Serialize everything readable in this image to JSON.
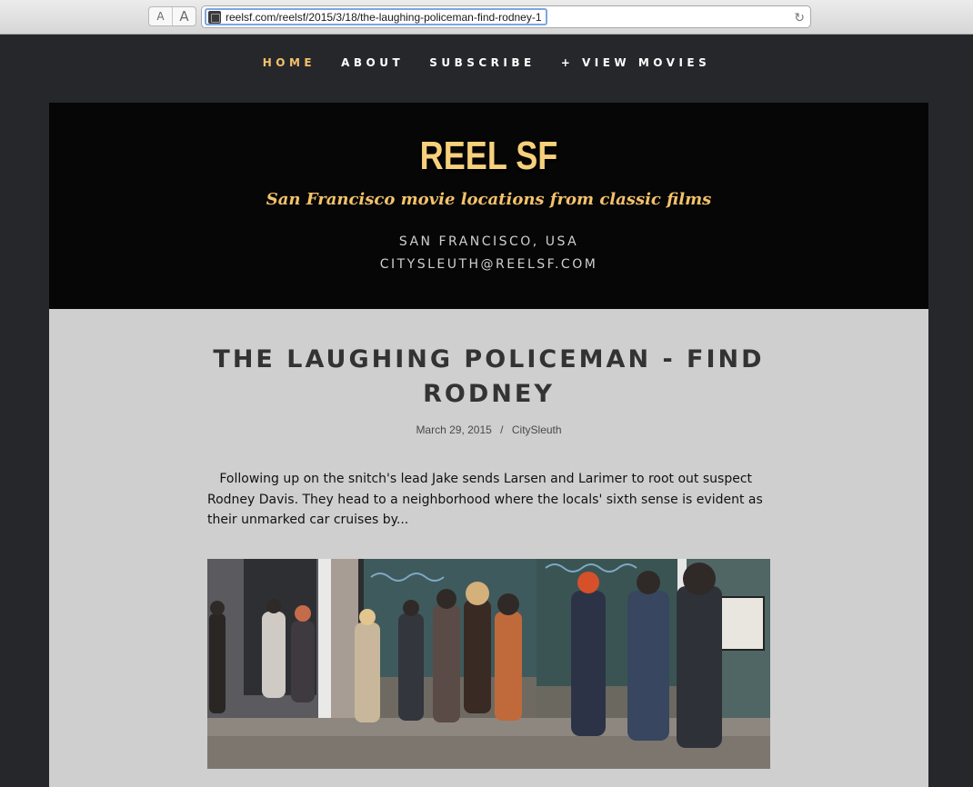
{
  "browser": {
    "font_small": "A",
    "font_large": "A",
    "url": "reelsf.com/reelsf/2015/3/18/the-laughing-policeman-find-rodney-1",
    "reload_icon": "reload-icon"
  },
  "nav": {
    "items": [
      {
        "label": "HOME",
        "active": true
      },
      {
        "label": "ABOUT"
      },
      {
        "label": "SUBSCRIBE"
      },
      {
        "label": "+ VIEW MOVIES"
      }
    ]
  },
  "header": {
    "title": "REEL SF",
    "tagline": "San Francisco movie locations from classic films",
    "location": "SAN FRANCISCO, USA",
    "email": "CITYSLEUTH@REELSF.COM"
  },
  "post": {
    "title_line1": "THE LAUGHING POLICEMAN - FIND",
    "title_line2": "RODNEY",
    "date": "March 29, 2015",
    "separator": "/",
    "author": "CitySleuth",
    "body": "Following up on the snitch's lead Jake sends Larsen and Larimer to root out suspect Rodney Davis.  They head to a neighborhood where the locals' sixth sense is evident as their unmarked car cruises by..."
  },
  "colors": {
    "accent": "#f4c26a",
    "page_bg": "#26272b",
    "header_bg": "#060606",
    "content_bg": "#cfcfcf"
  }
}
